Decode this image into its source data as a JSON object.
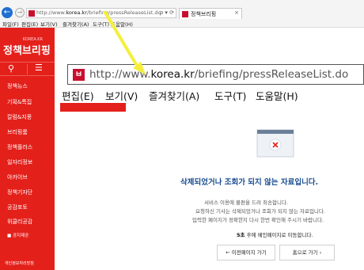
{
  "browser": {
    "url_prefix": "http://www.",
    "url_domain": "korea.kr",
    "url_path": "/briefing/pressReleaseList.do",
    "addr_tools": "ρ ▾ ⟳",
    "tab_title": "정책브리핑",
    "tab_close": "×",
    "back_icon": "←",
    "forward_icon": "→",
    "menu": [
      "파일(F)",
      "편집(E)",
      "보기(V)",
      "즐겨찾기(A)",
      "도구(T)",
      "도움말(H)"
    ]
  },
  "sidebar": {
    "logo_small": "KOREA.KR",
    "logo": "정책브리핑",
    "search_icon": "⚲",
    "menu_icon": "☰",
    "items": [
      "정책뉴스",
      "기획&특집",
      "칼럼&지풍",
      "브리핑룸",
      "정책플러스",
      "일자리정보",
      "아카이브",
      "정책기자단",
      "공감포토",
      "위클리공감",
      "공지제공",
      "개인정보처리방침"
    ]
  },
  "zoom": {
    "fav": "ㅂ",
    "url_prefix": "http://www.",
    "url_domain": "korea.kr",
    "url_path": "/briefing/pressReleaseList.do",
    "menu": [
      "편집(E)",
      "보기(V)",
      "즐겨찾기(A)",
      "도구(T)",
      "도움말(H)"
    ]
  },
  "error": {
    "title": "삭제되었거나 조회가 되지 않는 자료입니다.",
    "lines": [
      "서비스 이용에 불편을 드려 죄송합니다.",
      "요청하신 기사는 삭제되었거나 조회가 되지 않는 자료입니다.",
      "입력한 페이지가 정확한지 다시 한번 확인해 주시기 바랍니다."
    ],
    "redirect_seconds": "5초",
    "redirect_text": " 후에 메인페이지로 이동합니다.",
    "prev_button": "←  이전페이지 가기",
    "home_button": "홈으로 가기  ›"
  },
  "colors": {
    "brand_red": "#e4201b",
    "title_blue": "#1a4d8f",
    "arrow_yellow": "#f5ef3a"
  }
}
